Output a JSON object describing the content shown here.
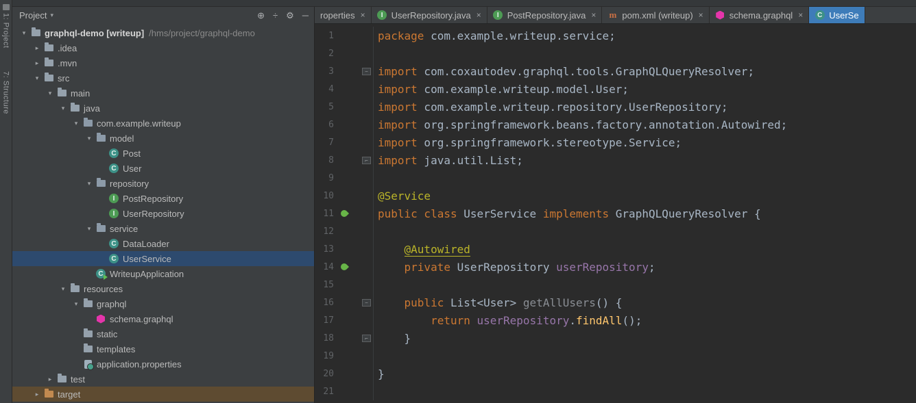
{
  "tool_stripe": {
    "items": [
      {
        "label": "1: Project"
      },
      {
        "label": "7: Structure"
      }
    ]
  },
  "project_panel": {
    "title": "Project",
    "header_icons": [
      {
        "name": "locate-file",
        "glyph": "⊕"
      },
      {
        "name": "collapse-all",
        "glyph": "÷"
      },
      {
        "name": "settings-gear",
        "glyph": "⚙"
      },
      {
        "name": "hide-panel",
        "glyph": "─"
      }
    ],
    "tree": [
      {
        "label": "graphql-demo [writeup]",
        "path": "/hms/project/graphql-demo",
        "level": 0,
        "arrow": "expanded",
        "icon": "folder",
        "emphasis": true
      },
      {
        "label": ".idea",
        "level": 1,
        "arrow": "collapsed",
        "icon": "folder"
      },
      {
        "label": ".mvn",
        "level": 1,
        "arrow": "collapsed",
        "icon": "folder"
      },
      {
        "label": "src",
        "level": 1,
        "arrow": "expanded",
        "icon": "folder"
      },
      {
        "label": "main",
        "level": 2,
        "arrow": "expanded",
        "icon": "folder"
      },
      {
        "label": "java",
        "level": 3,
        "arrow": "expanded",
        "icon": "folder"
      },
      {
        "label": "com.example.writeup",
        "level": 4,
        "arrow": "expanded",
        "icon": "package"
      },
      {
        "label": "model",
        "level": 5,
        "arrow": "expanded",
        "icon": "package"
      },
      {
        "label": "Post",
        "level": 6,
        "icon": "class"
      },
      {
        "label": "User",
        "level": 6,
        "icon": "class"
      },
      {
        "label": "repository",
        "level": 5,
        "arrow": "expanded",
        "icon": "package"
      },
      {
        "label": "PostRepository",
        "level": 6,
        "icon": "interface"
      },
      {
        "label": "UserRepository",
        "level": 6,
        "icon": "interface"
      },
      {
        "label": "service",
        "level": 5,
        "arrow": "expanded",
        "icon": "package"
      },
      {
        "label": "DataLoader",
        "level": 6,
        "icon": "class"
      },
      {
        "label": "UserService",
        "level": 6,
        "icon": "class",
        "selected": true
      },
      {
        "label": "WriteupApplication",
        "level": 5,
        "icon": "class-run"
      },
      {
        "label": "resources",
        "level": 3,
        "arrow": "expanded",
        "icon": "folder"
      },
      {
        "label": "graphql",
        "level": 4,
        "arrow": "expanded",
        "icon": "folder"
      },
      {
        "label": "schema.graphql",
        "level": 5,
        "icon": "graphql"
      },
      {
        "label": "static",
        "level": 4,
        "icon": "folder"
      },
      {
        "label": "templates",
        "level": 4,
        "icon": "folder"
      },
      {
        "label": "application.properties",
        "level": 4,
        "icon": "properties"
      },
      {
        "label": "test",
        "level": 2,
        "arrow": "collapsed",
        "icon": "folder"
      },
      {
        "label": "target",
        "level": 1,
        "arrow": "collapsed",
        "icon": "folder-excluded",
        "row_highlight": true
      }
    ]
  },
  "editor": {
    "tabs": [
      {
        "label": "roperties",
        "icon": null,
        "active": false,
        "partial": true,
        "show_close": true
      },
      {
        "label": "UserRepository.java",
        "icon": "interface",
        "active": false,
        "show_close": true
      },
      {
        "label": "PostRepository.java",
        "icon": "interface",
        "active": false,
        "show_close": true
      },
      {
        "label": "pom.xml (writeup)",
        "icon": "maven",
        "active": false,
        "show_close": true
      },
      {
        "label": "schema.graphql",
        "icon": "graphql",
        "active": false,
        "show_close": true
      },
      {
        "label": "UserSe",
        "icon": "class",
        "active": true,
        "partial": true,
        "show_close": false
      }
    ],
    "gutter": {
      "bean_lines": [
        11,
        14
      ],
      "fold_open_lines": [
        3,
        16
      ],
      "fold_close_lines": [
        8,
        18
      ]
    },
    "code": {
      "language": "java",
      "file": "UserService.java",
      "lines": [
        {
          "n": 1,
          "tokens": [
            [
              "kw",
              "package"
            ],
            [
              "pl",
              " com.example.writeup.service;"
            ]
          ]
        },
        {
          "n": 2,
          "tokens": []
        },
        {
          "n": 3,
          "tokens": [
            [
              "kw",
              "import"
            ],
            [
              "pl",
              " com.coxautodev.graphql.tools.GraphQLQueryResolver;"
            ]
          ]
        },
        {
          "n": 4,
          "tokens": [
            [
              "kw",
              "import"
            ],
            [
              "pl",
              " com.example.writeup.model.User;"
            ]
          ]
        },
        {
          "n": 5,
          "tokens": [
            [
              "kw",
              "import"
            ],
            [
              "pl",
              " com.example.writeup.repository.UserRepository;"
            ]
          ]
        },
        {
          "n": 6,
          "tokens": [
            [
              "kw",
              "import"
            ],
            [
              "pl",
              " org.springframework.beans.factory.annotation.Autowired;"
            ]
          ]
        },
        {
          "n": 7,
          "tokens": [
            [
              "kw",
              "import"
            ],
            [
              "pl",
              " org.springframework.stereotype.Service;"
            ]
          ]
        },
        {
          "n": 8,
          "tokens": [
            [
              "kw",
              "import"
            ],
            [
              "pl",
              " java.util.List;"
            ]
          ]
        },
        {
          "n": 9,
          "tokens": []
        },
        {
          "n": 10,
          "tokens": [
            [
              "ann",
              "@Service"
            ]
          ]
        },
        {
          "n": 11,
          "tokens": [
            [
              "kw",
              "public class"
            ],
            [
              "pl",
              " UserService "
            ],
            [
              "kw",
              "implements"
            ],
            [
              "pl",
              " GraphQLQueryResolver {"
            ]
          ]
        },
        {
          "n": 12,
          "tokens": []
        },
        {
          "n": 13,
          "tokens": [
            [
              "pl",
              "    "
            ],
            [
              "annu",
              "@Autowired"
            ]
          ]
        },
        {
          "n": 14,
          "tokens": [
            [
              "pl",
              "    "
            ],
            [
              "kw",
              "private"
            ],
            [
              "pl",
              " UserRepository "
            ],
            [
              "fld",
              "userRepository"
            ],
            [
              "pl",
              ";"
            ]
          ]
        },
        {
          "n": 15,
          "tokens": []
        },
        {
          "n": 16,
          "tokens": [
            [
              "pl",
              "    "
            ],
            [
              "kw",
              "public"
            ],
            [
              "pl",
              " List<User> "
            ],
            [
              "unused",
              "getAllUsers"
            ],
            [
              "pl",
              "() {"
            ]
          ]
        },
        {
          "n": 17,
          "tokens": [
            [
              "pl",
              "        "
            ],
            [
              "kw",
              "return"
            ],
            [
              "pl",
              " "
            ],
            [
              "fld",
              "userRepository"
            ],
            [
              "pl",
              "."
            ],
            [
              "mth",
              "findAll"
            ],
            [
              "pl",
              "();"
            ]
          ]
        },
        {
          "n": 18,
          "tokens": [
            [
              "pl",
              "    }"
            ]
          ]
        },
        {
          "n": 19,
          "tokens": []
        },
        {
          "n": 20,
          "tokens": [
            [
              "pl",
              "}"
            ]
          ]
        },
        {
          "n": 21,
          "tokens": []
        }
      ]
    }
  },
  "colors": {
    "editor_background": "#2B2B2B",
    "panel_background": "#3C3F41",
    "selection_blue": "#2D4A6E",
    "excluded_row_brown": "#5E4B31",
    "active_tab_blue": "#3E7CB9",
    "keyword_orange": "#CC7832",
    "annotation_yellow": "#BBB529",
    "field_purple": "#9876AA",
    "method_yellow": "#FFC66D",
    "plain_text": "#A9B7C6",
    "line_number_gray": "#606366",
    "graphql_pink": "#E535AB",
    "spring_bean_green": "#68B548",
    "interface_green": "#4D9B54",
    "class_teal": "#3D9187"
  }
}
